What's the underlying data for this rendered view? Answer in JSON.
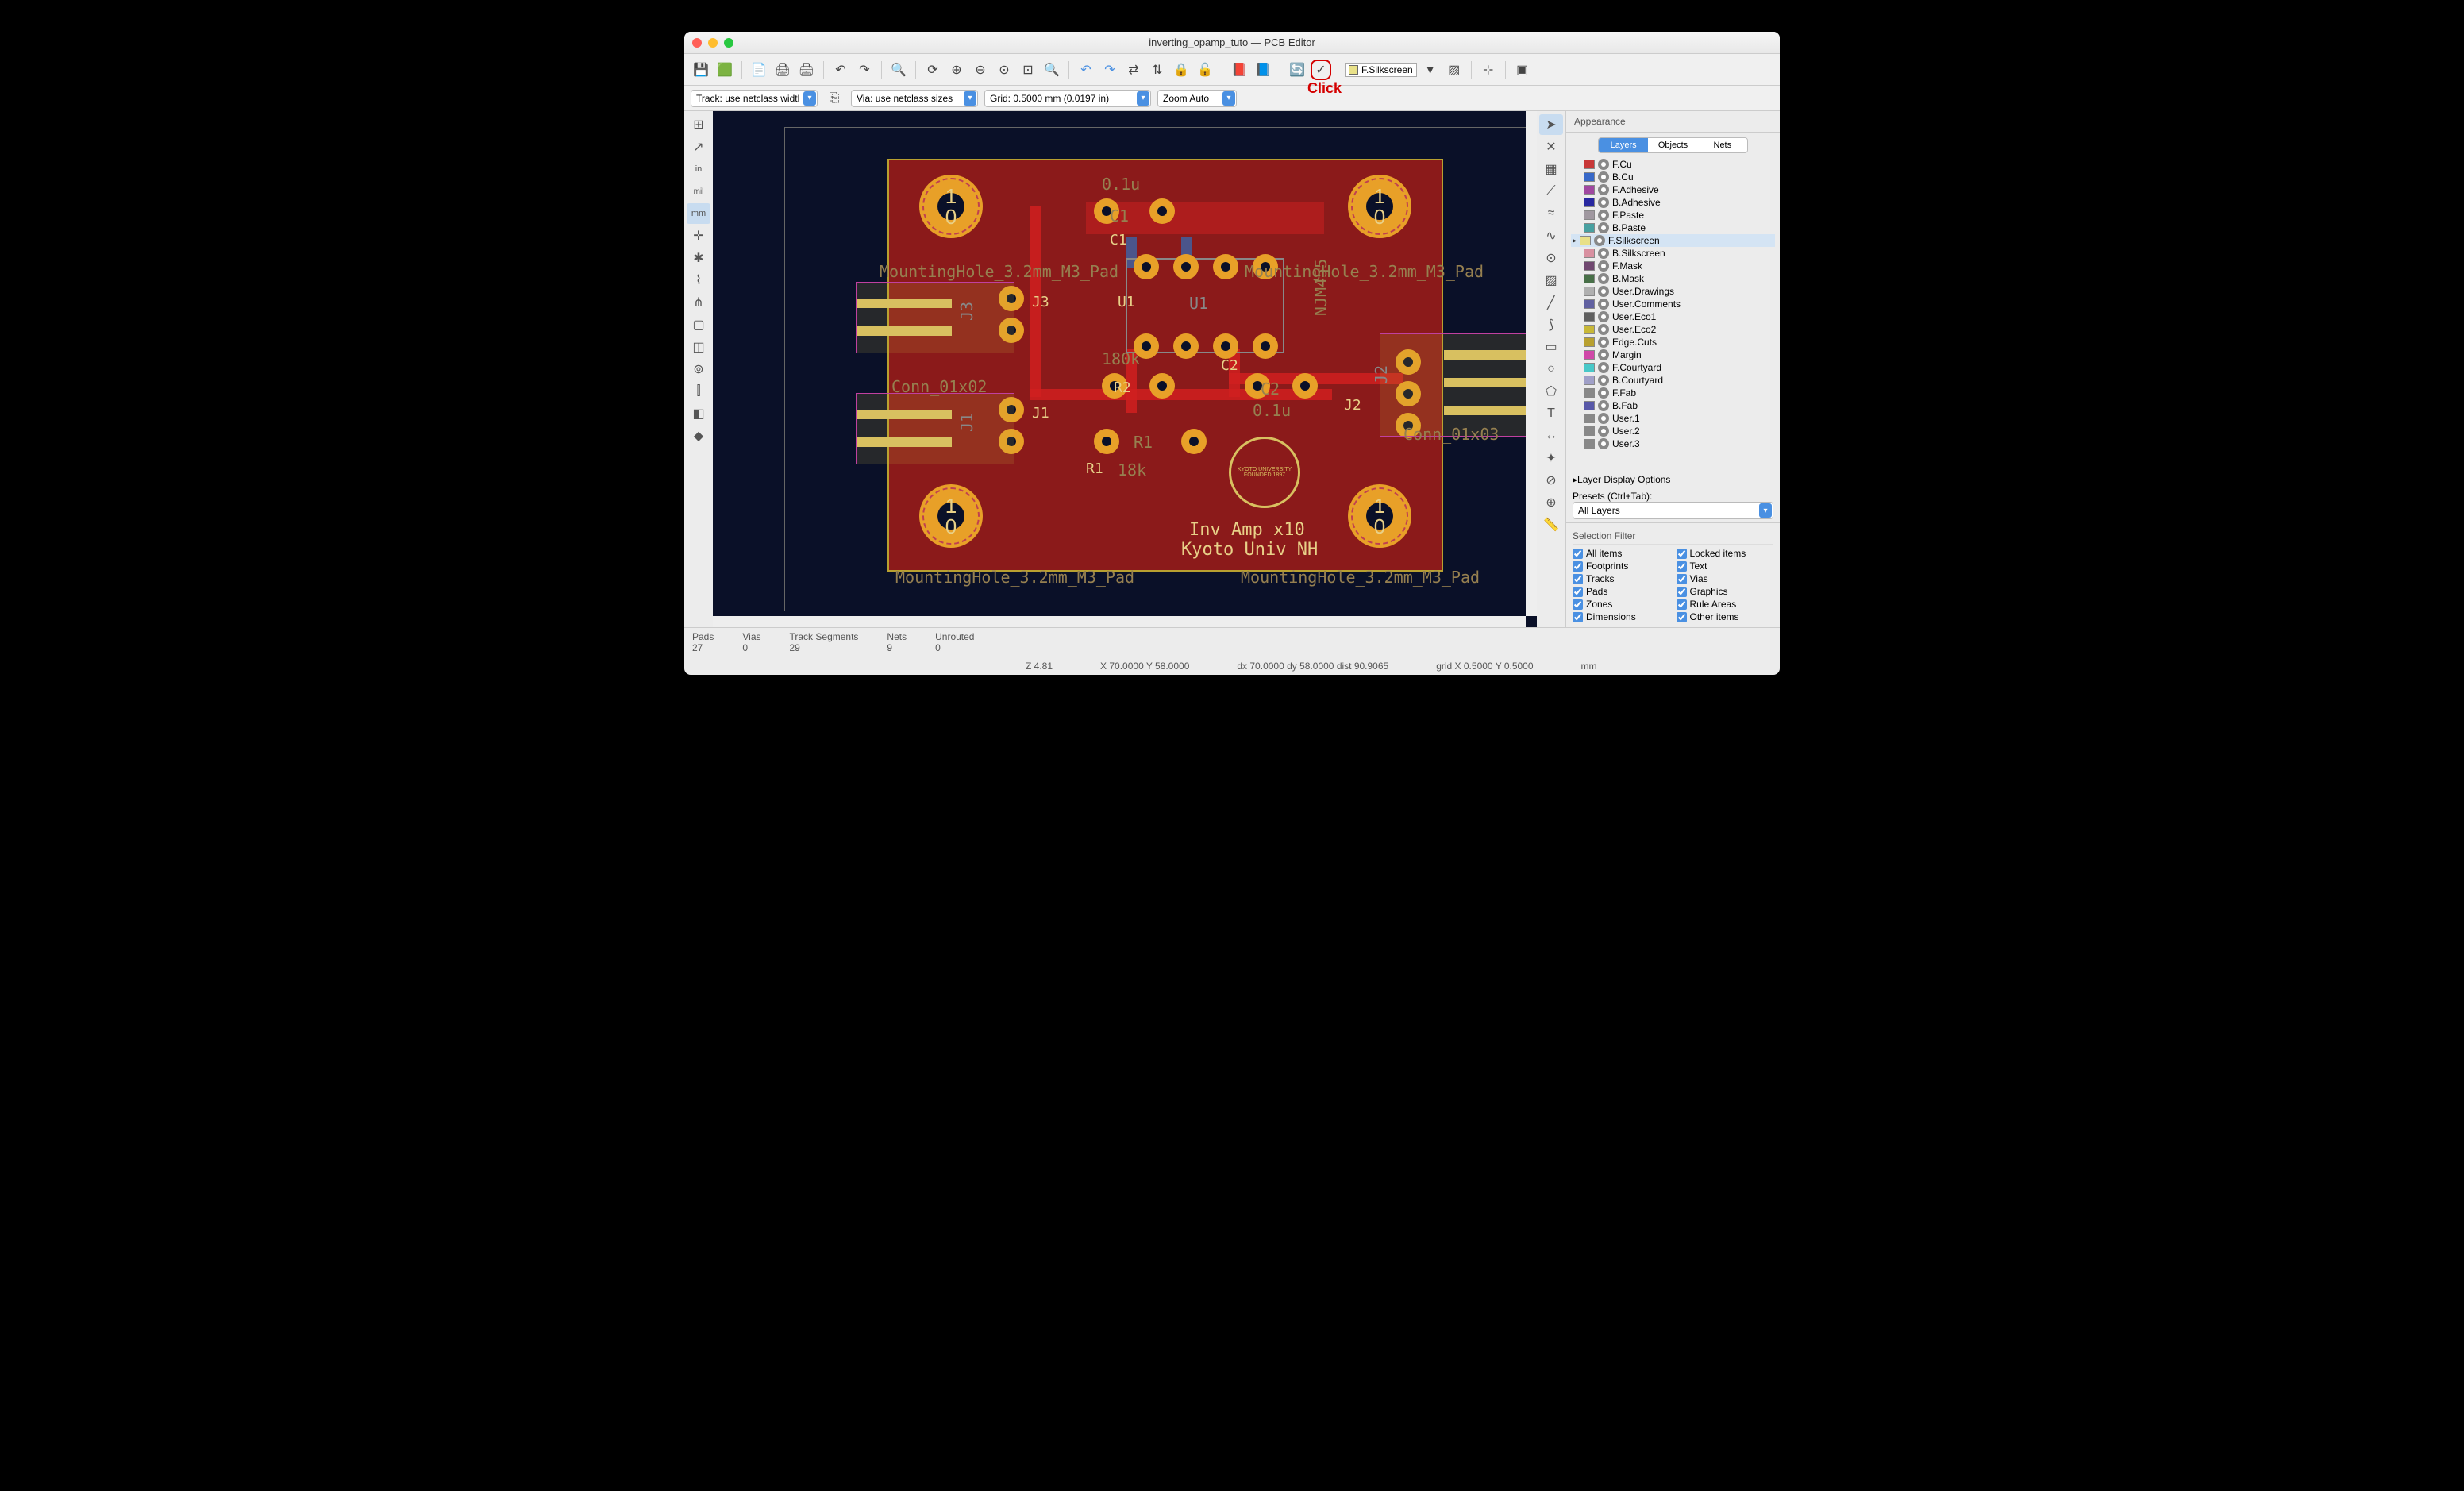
{
  "title": "inverting_opamp_tuto — PCB Editor",
  "annotation": "Click",
  "toolbar2": {
    "track": "Track: use netclass width",
    "via": "Via: use netclass sizes",
    "grid": "Grid: 0.5000 mm (0.0197 in)",
    "zoom": "Zoom Auto"
  },
  "active_layer": "F.Silkscreen",
  "panel": {
    "title": "Appearance",
    "tabs": [
      "Layers",
      "Objects",
      "Nets"
    ],
    "layers": [
      {
        "name": "F.Cu",
        "color": "#c83838"
      },
      {
        "name": "B.Cu",
        "color": "#3868c8"
      },
      {
        "name": "F.Adhesive",
        "color": "#a048a0"
      },
      {
        "name": "B.Adhesive",
        "color": "#2828a0"
      },
      {
        "name": "F.Paste",
        "color": "#a098a0"
      },
      {
        "name": "B.Paste",
        "color": "#48a0a0"
      },
      {
        "name": "F.Silkscreen",
        "color": "#e8e088",
        "selected": true
      },
      {
        "name": "B.Silkscreen",
        "color": "#d890a0"
      },
      {
        "name": "F.Mask",
        "color": "#704870"
      },
      {
        "name": "B.Mask",
        "color": "#487048"
      },
      {
        "name": "User.Drawings",
        "color": "#b0b0b0"
      },
      {
        "name": "User.Comments",
        "color": "#6060a0"
      },
      {
        "name": "User.Eco1",
        "color": "#606060"
      },
      {
        "name": "User.Eco2",
        "color": "#c8b838"
      },
      {
        "name": "Edge.Cuts",
        "color": "#b8a030"
      },
      {
        "name": "Margin",
        "color": "#d048a8"
      },
      {
        "name": "F.Courtyard",
        "color": "#48c8c8"
      },
      {
        "name": "B.Courtyard",
        "color": "#a0a0c8"
      },
      {
        "name": "F.Fab",
        "color": "#888888"
      },
      {
        "name": "B.Fab",
        "color": "#5858a8"
      },
      {
        "name": "User.1",
        "color": "#888888"
      },
      {
        "name": "User.2",
        "color": "#888888"
      },
      {
        "name": "User.3",
        "color": "#888888"
      }
    ],
    "display_options": "Layer Display Options",
    "presets_label": "Presets (Ctrl+Tab):",
    "presets_value": "All Layers",
    "selfilter_title": "Selection Filter",
    "checks": [
      "All items",
      "Locked items",
      "Footprints",
      "Text",
      "Tracks",
      "Vias",
      "Pads",
      "Graphics",
      "Zones",
      "Rule Areas",
      "Dimensions",
      "Other items"
    ]
  },
  "stats": {
    "pads_l": "Pads",
    "pads_v": "27",
    "vias_l": "Vias",
    "vias_v": "0",
    "tracks_l": "Track Segments",
    "tracks_v": "29",
    "nets_l": "Nets",
    "nets_v": "9",
    "unrouted_l": "Unrouted",
    "unrouted_v": "0"
  },
  "status": {
    "z": "Z 4.81",
    "xy": "X 70.0000  Y 58.0000",
    "dxy": "dx 70.0000  dy 58.0000  dist 90.9065",
    "grid": "grid X 0.5000  Y 0.5000",
    "unit": "mm"
  },
  "pcb_text": {
    "c1v": "0.1u",
    "c1": "C1",
    "c1s": "C1",
    "u1": "U1",
    "u1f": "U1",
    "u1p": "NJM455",
    "r2": "R2",
    "r2v": "180k",
    "c2": "C2",
    "c2f": "C2",
    "c2v": "0.1u",
    "j1": "J1",
    "j1f": "J1",
    "j2": "J2",
    "j2f": "J2",
    "j3": "J3",
    "j3f": "J3",
    "r1": "R1",
    "r1f": "R1",
    "r1v": "18k",
    "conn2": "Conn_01x02",
    "conn3": "Conn_01x03",
    "title1": "Inv Amp x10",
    "title2": "Kyoto Univ NH",
    "mh": "MountingHole_3.2mm_M3_Pad"
  }
}
